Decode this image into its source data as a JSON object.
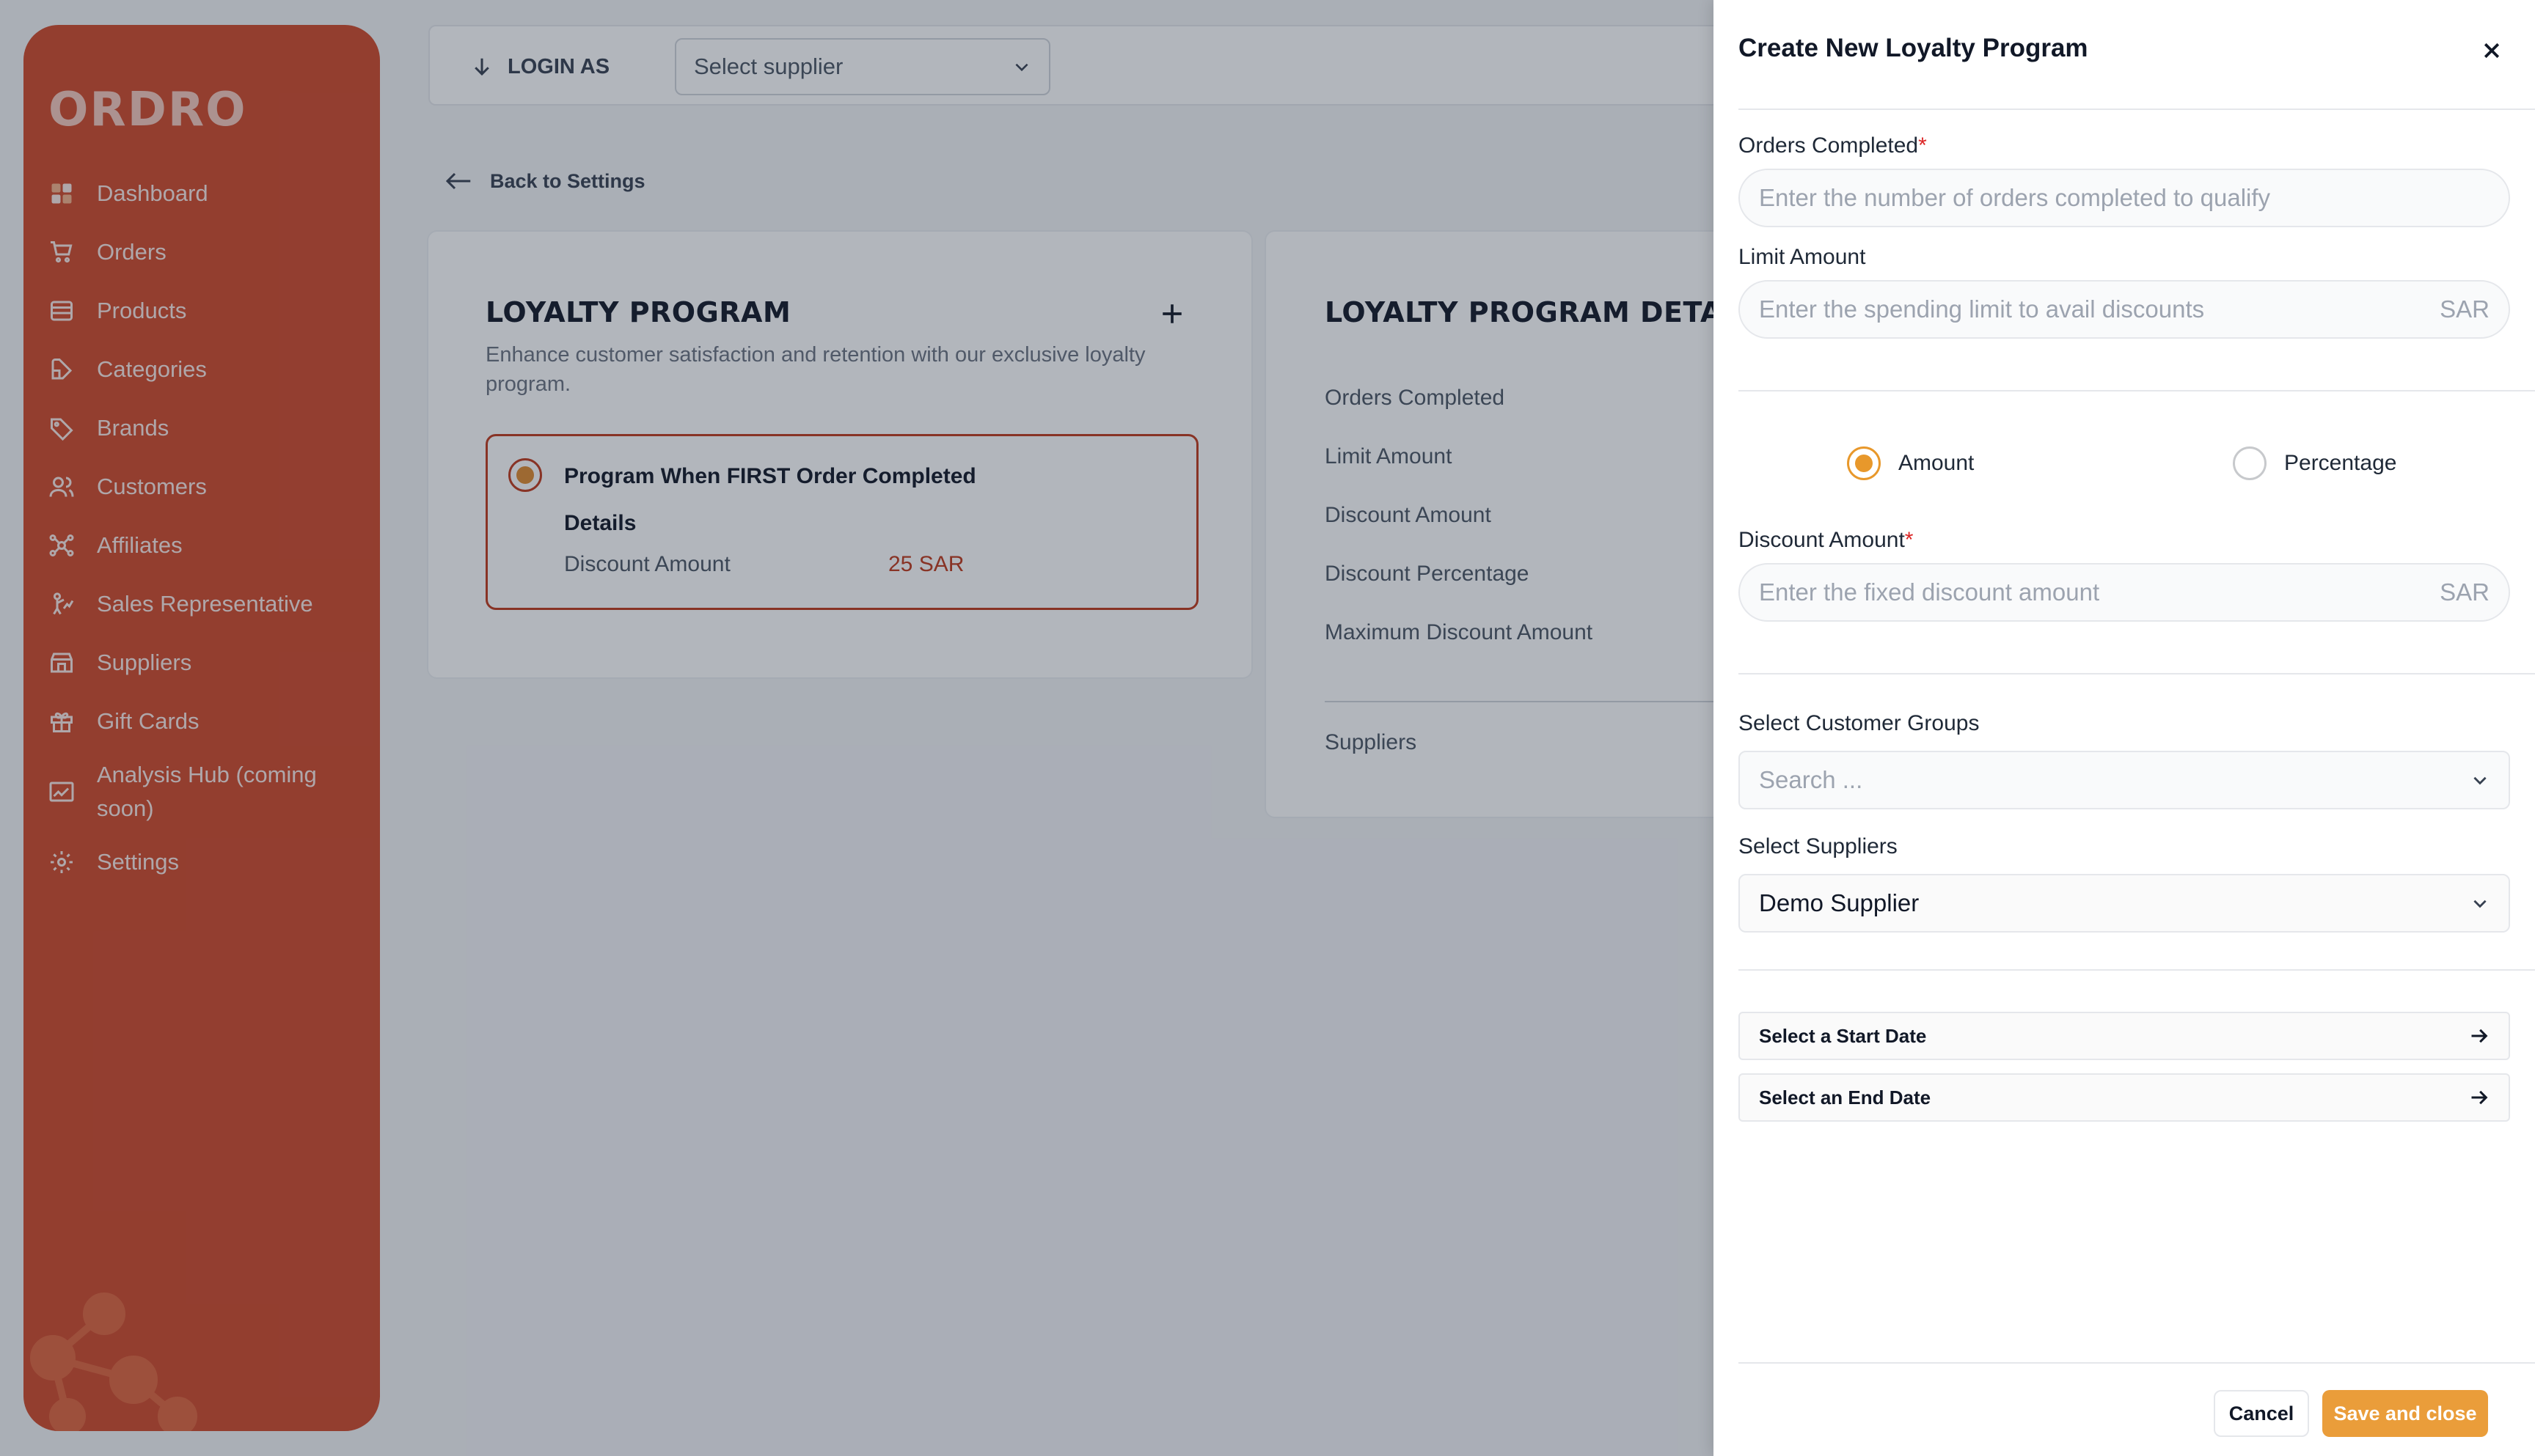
{
  "sidebar": {
    "logo": "ORDRO",
    "items": [
      {
        "label": "Dashboard"
      },
      {
        "label": "Orders"
      },
      {
        "label": "Products"
      },
      {
        "label": "Categories"
      },
      {
        "label": "Brands"
      },
      {
        "label": "Customers"
      },
      {
        "label": "Affiliates"
      },
      {
        "label": "Sales Representative"
      },
      {
        "label": "Suppliers"
      },
      {
        "label": "Gift Cards"
      },
      {
        "label": "Analysis Hub (coming soon)"
      },
      {
        "label": "Settings"
      }
    ]
  },
  "topbar": {
    "login_as": "LOGIN AS",
    "supplier_select": "Select supplier"
  },
  "back_link": "Back to Settings",
  "loyalty_card": {
    "title": "LOYALTY PROGRAM",
    "subtitle": "Enhance customer satisfaction and retention with our exclusive loyalty program.",
    "program": {
      "title": "Program When FIRST Order Completed",
      "details_label": "Details",
      "discount_label": "Discount Amount",
      "discount_value": "25 SAR"
    }
  },
  "detail_card": {
    "title": "LOYALTY PROGRAM DETAIL",
    "items": [
      "Orders Completed",
      "Limit Amount",
      "Discount Amount",
      "Discount Percentage",
      "Maximum Discount Amount"
    ],
    "suppliers_label": "Suppliers"
  },
  "drawer": {
    "title": "Create New Loyalty Program",
    "orders_completed": {
      "label": "Orders Completed",
      "required": "*",
      "placeholder": "Enter the number of orders completed to qualify"
    },
    "limit_amount": {
      "label": "Limit Amount",
      "placeholder": "Enter the spending limit to avail discounts",
      "suffix": "SAR"
    },
    "discount_type": {
      "amount": "Amount",
      "percentage": "Percentage",
      "selected": "Amount"
    },
    "discount_amount": {
      "label": "Discount Amount",
      "required": "*",
      "placeholder": "Enter the fixed discount amount",
      "suffix": "SAR"
    },
    "customer_groups": {
      "label": "Select Customer Groups",
      "placeholder": "Search ..."
    },
    "suppliers": {
      "label": "Select Suppliers",
      "value": "Demo Supplier"
    },
    "start_date": "Select a Start Date",
    "end_date": "Select an End Date",
    "cancel": "Cancel",
    "save": "Save and close"
  },
  "colors": {
    "sidebar": "#d0492a",
    "accent": "#ea9d3a",
    "program_border": "#c0391b"
  }
}
